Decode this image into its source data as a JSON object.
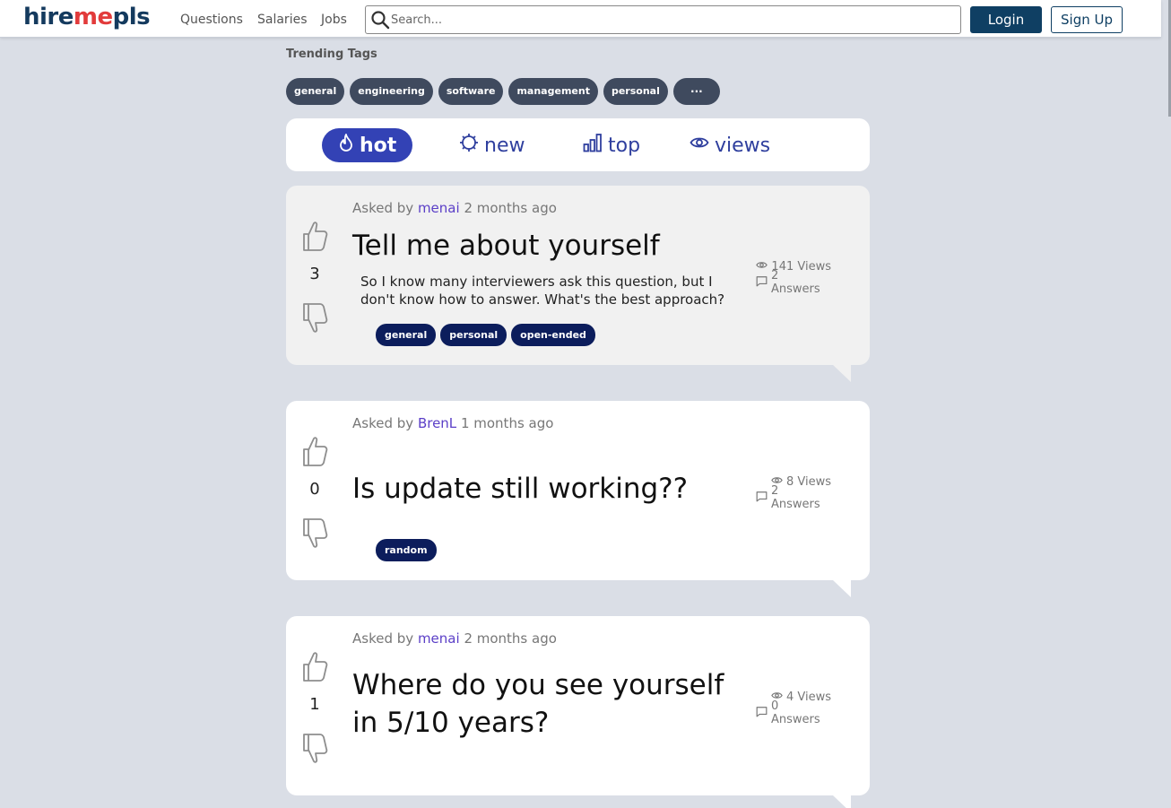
{
  "header": {
    "logo_main": "hire",
    "logo_accent": "me",
    "logo_end": "pls",
    "nav": [
      "Questions",
      "Salaries",
      "Jobs"
    ],
    "search_placeholder": "Search...",
    "login_label": "Login",
    "signup_label": "Sign Up"
  },
  "trending": {
    "title": "Trending Tags",
    "tags": [
      "general",
      "engineering",
      "software",
      "management",
      "personal"
    ],
    "more_label": "···"
  },
  "sort_tabs": [
    {
      "label": "hot",
      "icon": "flame-icon",
      "active": true
    },
    {
      "label": "new",
      "icon": "sun-icon",
      "active": false
    },
    {
      "label": "top",
      "icon": "bar-chart-icon",
      "active": false
    },
    {
      "label": "views",
      "icon": "eye-icon",
      "active": false
    }
  ],
  "questions": [
    {
      "asked_prefix": "Asked by",
      "user": "menai",
      "time": "2 months ago",
      "votes": "3",
      "title": "Tell me about yourself",
      "body": "So I know many interviewers ask this question, but I don't know how to answer. What's the best approach?",
      "views": "141 Views",
      "answers": "2 Answers",
      "tags": [
        "general",
        "personal",
        "open-ended"
      ]
    },
    {
      "asked_prefix": "Asked by",
      "user": "BrenL",
      "time": "1 months ago",
      "votes": "0",
      "title": "Is update still working??",
      "body": "",
      "views": "8 Views",
      "answers": "2 Answers",
      "tags": [
        "random"
      ]
    },
    {
      "asked_prefix": "Asked by",
      "user": "menai",
      "time": "2 months ago",
      "votes": "1",
      "title": "Where do you see yourself in 5/10 years?",
      "body": "",
      "views": "4 Views",
      "answers": "0 Answers",
      "tags": []
    }
  ],
  "colors": {
    "page_bg": "#dadee6",
    "brand": "#0f3f63",
    "active_tab": "#3342b5",
    "tag_dark": "#0c1d5c",
    "trend_tag": "#3f4a5e",
    "user_link": "#5b3fc7"
  }
}
